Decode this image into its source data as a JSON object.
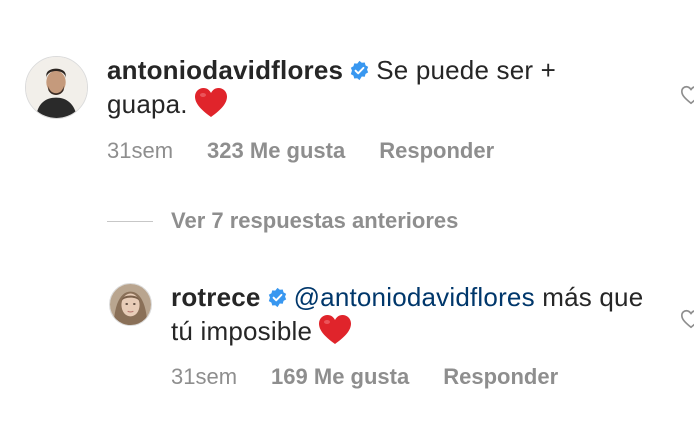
{
  "comments": [
    {
      "username": "antoniodavidflores",
      "verified": true,
      "text": "Se puede ser + guapa.",
      "emoji": "heart",
      "time": "31sem",
      "likes": "323 Me gusta",
      "reply_label": "Responder"
    },
    {
      "username": "rotrece",
      "verified": true,
      "mention": "@antoniodavidflores",
      "text": "más que tú imposible",
      "emoji": "heart",
      "time": "31sem",
      "likes": "169 Me gusta",
      "reply_label": "Responder"
    }
  ],
  "view_replies": {
    "label": "Ver 7 respuestas anteriores"
  },
  "icons": {
    "verified": "verified-badge-icon",
    "heart_emoji": "red-heart-emoji",
    "like": "heart-outline-icon"
  },
  "colors": {
    "verified_blue": "#3897f0",
    "mention_blue": "#00376b",
    "heart_red": "#e0242b",
    "meta_gray": "#8e8e8e"
  }
}
